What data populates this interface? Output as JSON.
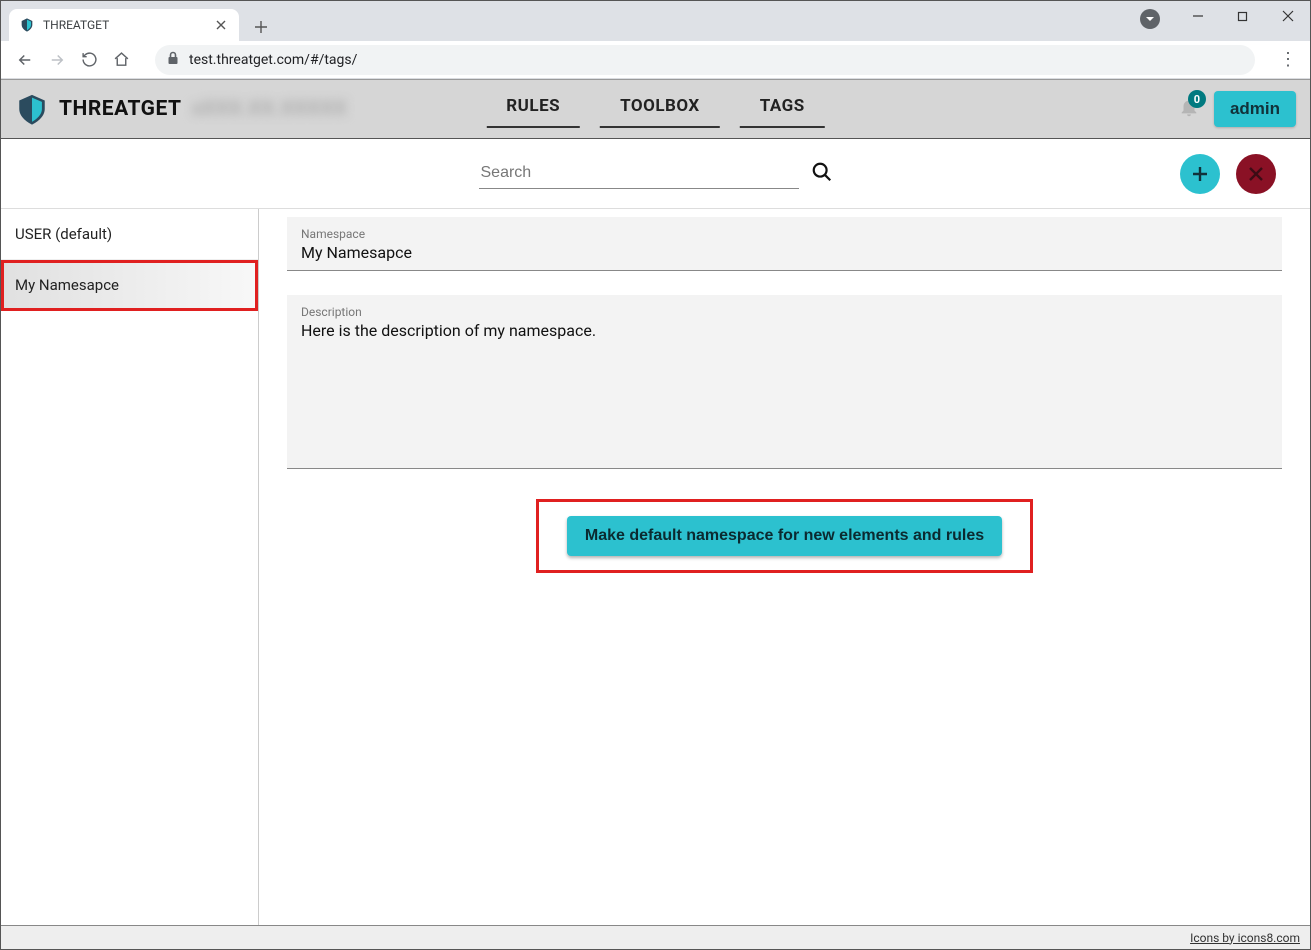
{
  "browser": {
    "tab_title": "THREATGET",
    "url": "test.threatget.com/#/tags/"
  },
  "header": {
    "app_title": "THREATGET",
    "version_blur": "xXXX.XX.XXXXX",
    "nav": {
      "rules": "RULES",
      "toolbox": "TOOLBOX",
      "tags": "TAGS"
    },
    "notification_count": "0",
    "admin_label": "admin"
  },
  "search": {
    "placeholder": "Search"
  },
  "sidebar": {
    "items": [
      {
        "label": "USER (default)"
      },
      {
        "label": "My Namesapce"
      }
    ]
  },
  "form": {
    "namespace_label": "Namespace",
    "namespace_value": "My Namesapce",
    "description_label": "Description",
    "description_value": "Here is the description of my namespace."
  },
  "buttons": {
    "make_default": "Make default namespace for new elements and rules"
  },
  "footer": {
    "icons8": "Icons by icons8.com"
  }
}
